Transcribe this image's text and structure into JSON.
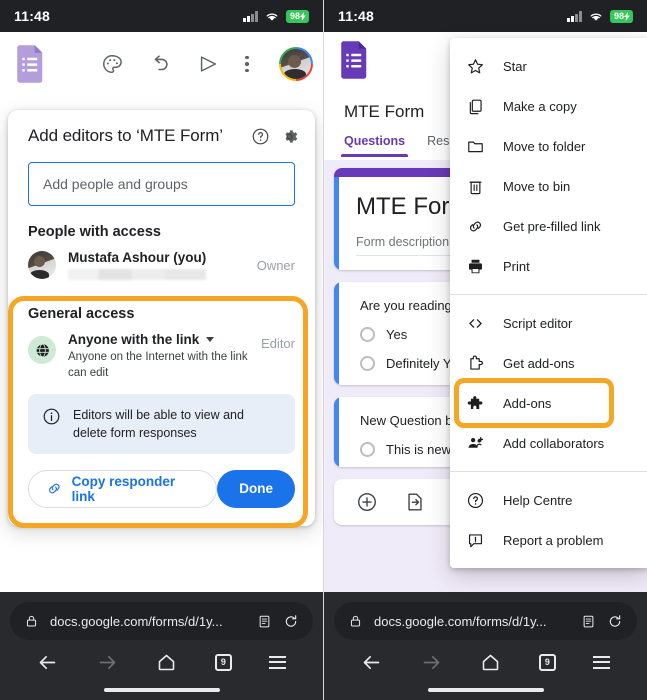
{
  "status_bar": {
    "time": "11:48",
    "battery": "98",
    "battery_charging": true,
    "signal_icon": "signal-bars-icon",
    "wifi_icon": "wifi-icon"
  },
  "left": {
    "app_icon": "google-forms-icon",
    "toolbar": {
      "theme_label": "palette-icon",
      "undo_label": "undo-icon",
      "send_label": "send-icon",
      "more_label": "more-vert-icon",
      "account_label": "account-avatar"
    },
    "dialog": {
      "title": "Add editors to ‘MTE Form’",
      "help_icon": "help-circle-icon",
      "settings_icon": "gear-icon",
      "search_placeholder": "Add people and groups",
      "people_heading": "People with access",
      "person": {
        "name": "Mustafa Ashour (you)",
        "role": "Owner",
        "avatar": "person-avatar"
      },
      "general": {
        "heading": "General access",
        "link_label": "Anyone with the link",
        "description": "Anyone on the Internet with the link can edit",
        "role": "Editor",
        "globe_icon": "globe-icon",
        "caret_icon": "chevron-down-icon"
      },
      "notice": {
        "icon": "info-icon",
        "text": "Editors will be able to view and delete form responses"
      },
      "copy_link_button": "Copy responder link",
      "copy_link_icon": "link-icon",
      "done_button": "Done"
    },
    "highlight_color": "#f5a623"
  },
  "right": {
    "app_icon": "google-forms-icon",
    "form_title": "MTE Form",
    "tabs": [
      {
        "label": "Questions",
        "active": true
      },
      {
        "label": "Respo",
        "active": false
      }
    ],
    "hero": {
      "title": "MTE For",
      "description": "Form description"
    },
    "question1": {
      "text": "Are you reading N",
      "options": [
        "Yes",
        "Definitely Yes"
      ]
    },
    "question2": {
      "text": "New Question by",
      "options": [
        "This is new."
      ]
    },
    "question_bar": {
      "add_icon": "add-circle-icon",
      "import_icon": "import-questions-icon"
    },
    "menu": {
      "groups": [
        [
          {
            "label": "Star",
            "icon": "star-icon"
          },
          {
            "label": "Make a copy",
            "icon": "copy-icon"
          },
          {
            "label": "Move to folder",
            "icon": "folder-icon"
          },
          {
            "label": "Move to bin",
            "icon": "trash-icon"
          },
          {
            "label": "Get pre-filled link",
            "icon": "link-icon"
          },
          {
            "label": "Print",
            "icon": "print-icon"
          }
        ],
        [
          {
            "label": "Script editor",
            "icon": "code-icon"
          },
          {
            "label": "Get add-ons",
            "icon": "puzzle-outline-icon"
          },
          {
            "label": "Add-ons",
            "icon": "puzzle-filled-icon"
          },
          {
            "label": "Add collaborators",
            "icon": "add-collaborators-icon",
            "highlighted": true
          }
        ],
        [
          {
            "label": "Help Centre",
            "icon": "help-circle-icon"
          },
          {
            "label": "Report a problem",
            "icon": "report-problem-icon"
          }
        ]
      ]
    },
    "highlight_color": "#f5a623"
  },
  "browser": {
    "url": "docs.google.com/forms/d/1y...",
    "lock_icon": "lock-icon",
    "reader_icon": "reader-mode-icon",
    "reload_icon": "reload-icon",
    "back_icon": "arrow-back-icon",
    "forward_icon": "arrow-forward-icon",
    "home_icon": "home-icon",
    "tab_count": "9",
    "menu_icon": "hamburger-menu-icon"
  },
  "theme": {
    "purple": "#673AB7",
    "blue": "#1a73e8",
    "highlight": "#f5a623",
    "green": "#ceead6"
  }
}
